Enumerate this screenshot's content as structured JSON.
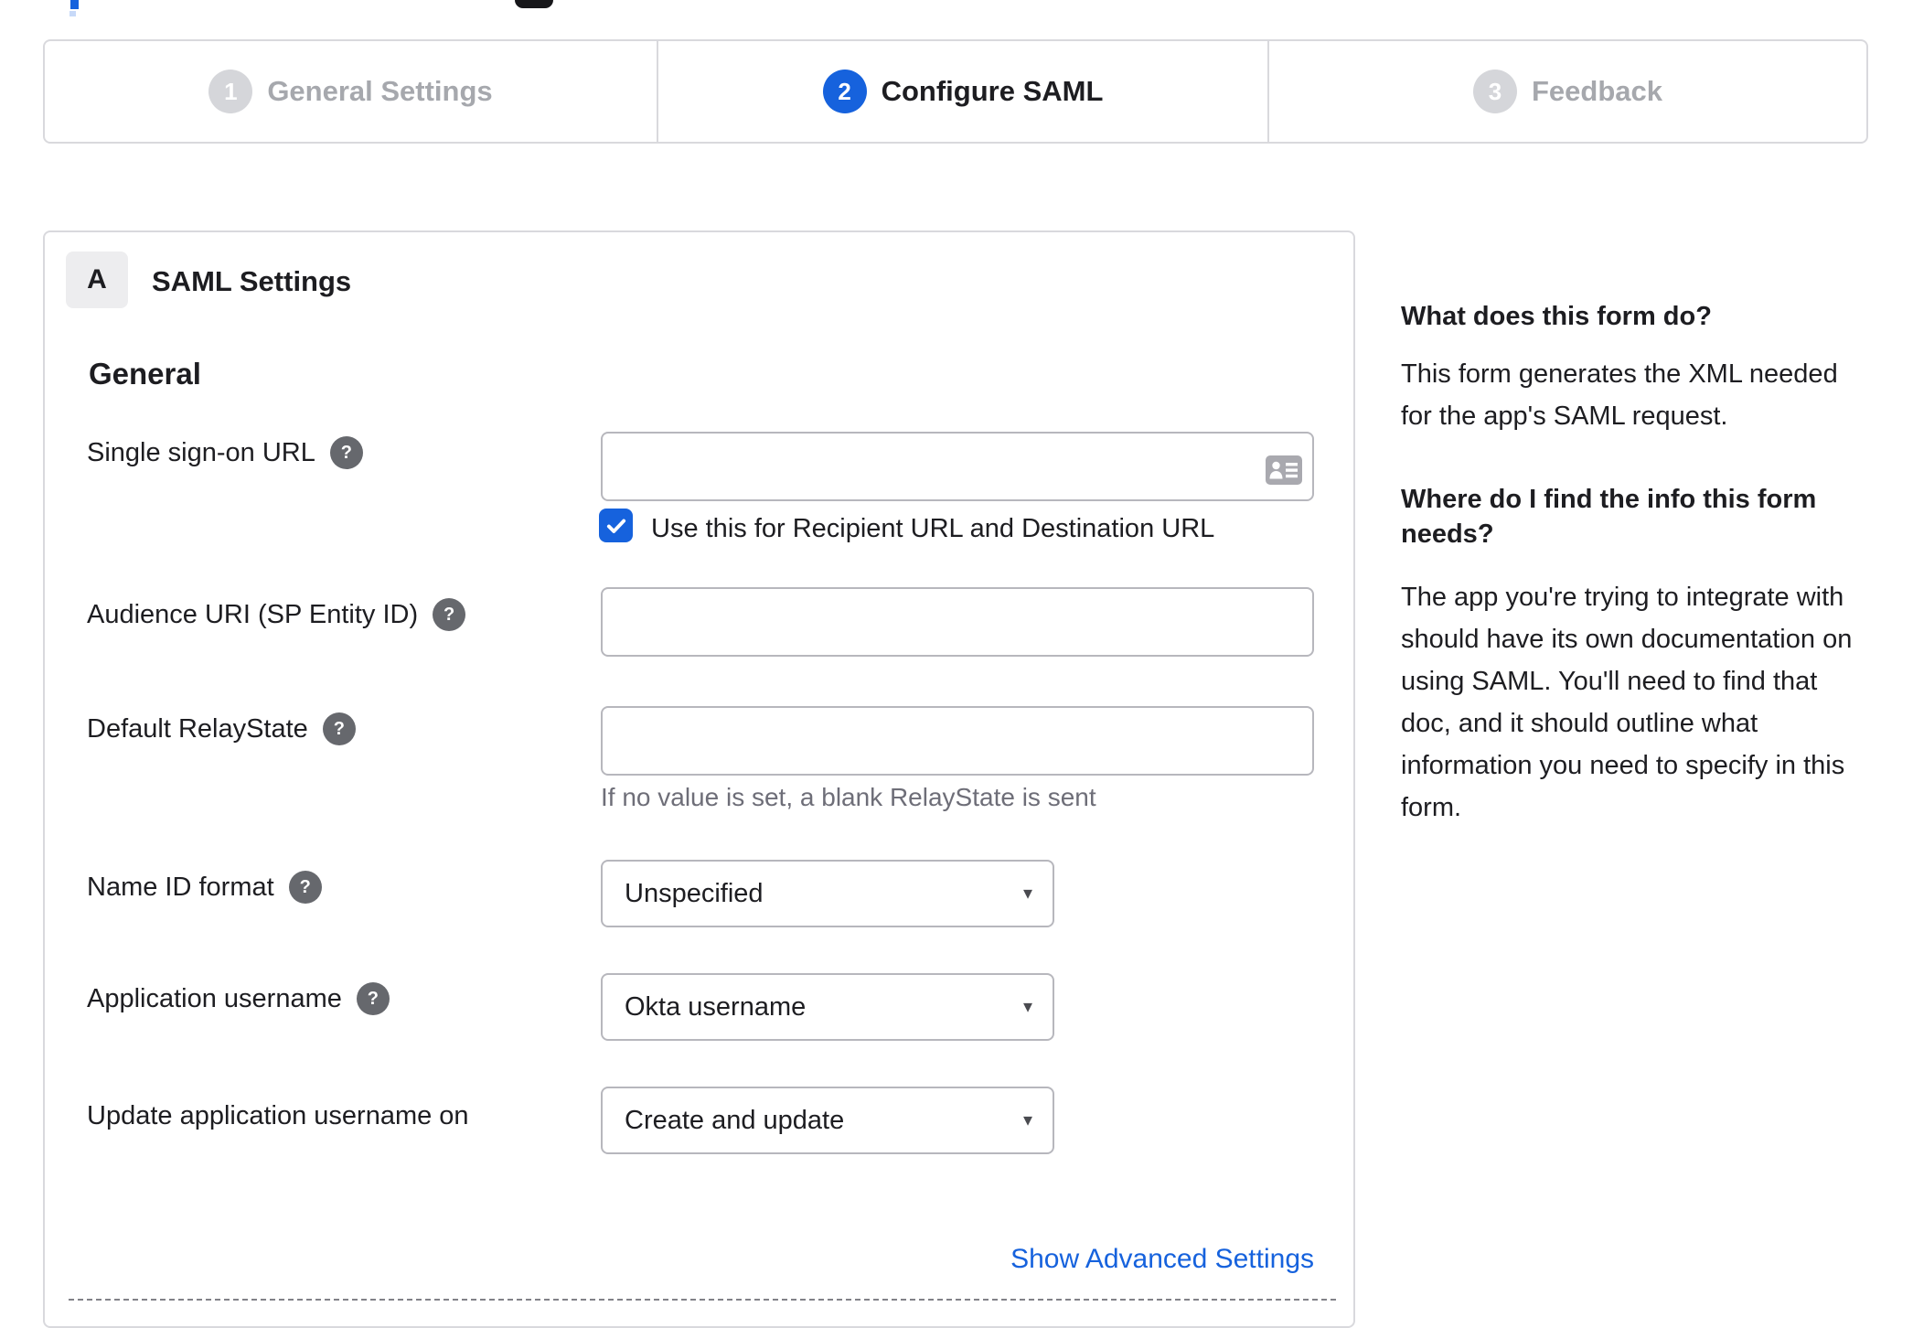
{
  "colors": {
    "accent_blue": "#1662dd",
    "text_dark": "#1d1d21",
    "inactive_gray": "#a6a8ad",
    "hint_gray": "#6e6e78",
    "border_light": "#d9d9dd",
    "border_input": "#b7b7bd",
    "help_icon_bg": "#66686d",
    "badge_bg": "#ededef"
  },
  "stepper": {
    "steps": [
      {
        "number": "1",
        "label": "General Settings",
        "state": "inactive"
      },
      {
        "number": "2",
        "label": "Configure SAML",
        "state": "active"
      },
      {
        "number": "3",
        "label": "Feedback",
        "state": "inactive"
      }
    ]
  },
  "panel": {
    "badge": "A",
    "title": "SAML Settings",
    "section": "General",
    "rows": {
      "sso": {
        "label": "Single sign-on URL",
        "value": "",
        "has_help": true
      },
      "audience": {
        "label": "Audience URI (SP Entity ID)",
        "value": "",
        "has_help": true
      },
      "relay": {
        "label": "Default RelayState",
        "value": "",
        "hint": "If no value is set, a blank RelayState is sent",
        "has_help": true
      },
      "nameid": {
        "label": "Name ID format",
        "value": "Unspecified",
        "has_help": true
      },
      "appuser": {
        "label": "Application username",
        "value": "Okta username",
        "has_help": true
      },
      "update": {
        "label": "Update application username on",
        "value": "Create and update",
        "has_help": false
      }
    },
    "checkbox": {
      "checked": true,
      "label": "Use this for Recipient URL and Destination URL"
    },
    "advanced_link": "Show Advanced Settings"
  },
  "sidebar": {
    "heading1": "What does this form do?",
    "para1": "This form generates the XML needed for the app's SAML request.",
    "heading2": "Where do I find the info this form needs?",
    "para2": "The app you're trying to integrate with should have its own documentation on using SAML. You'll need to find that doc, and it should outline what information you need to specify in this form."
  },
  "icons": {
    "help": "?",
    "select_arrow": "▾"
  }
}
